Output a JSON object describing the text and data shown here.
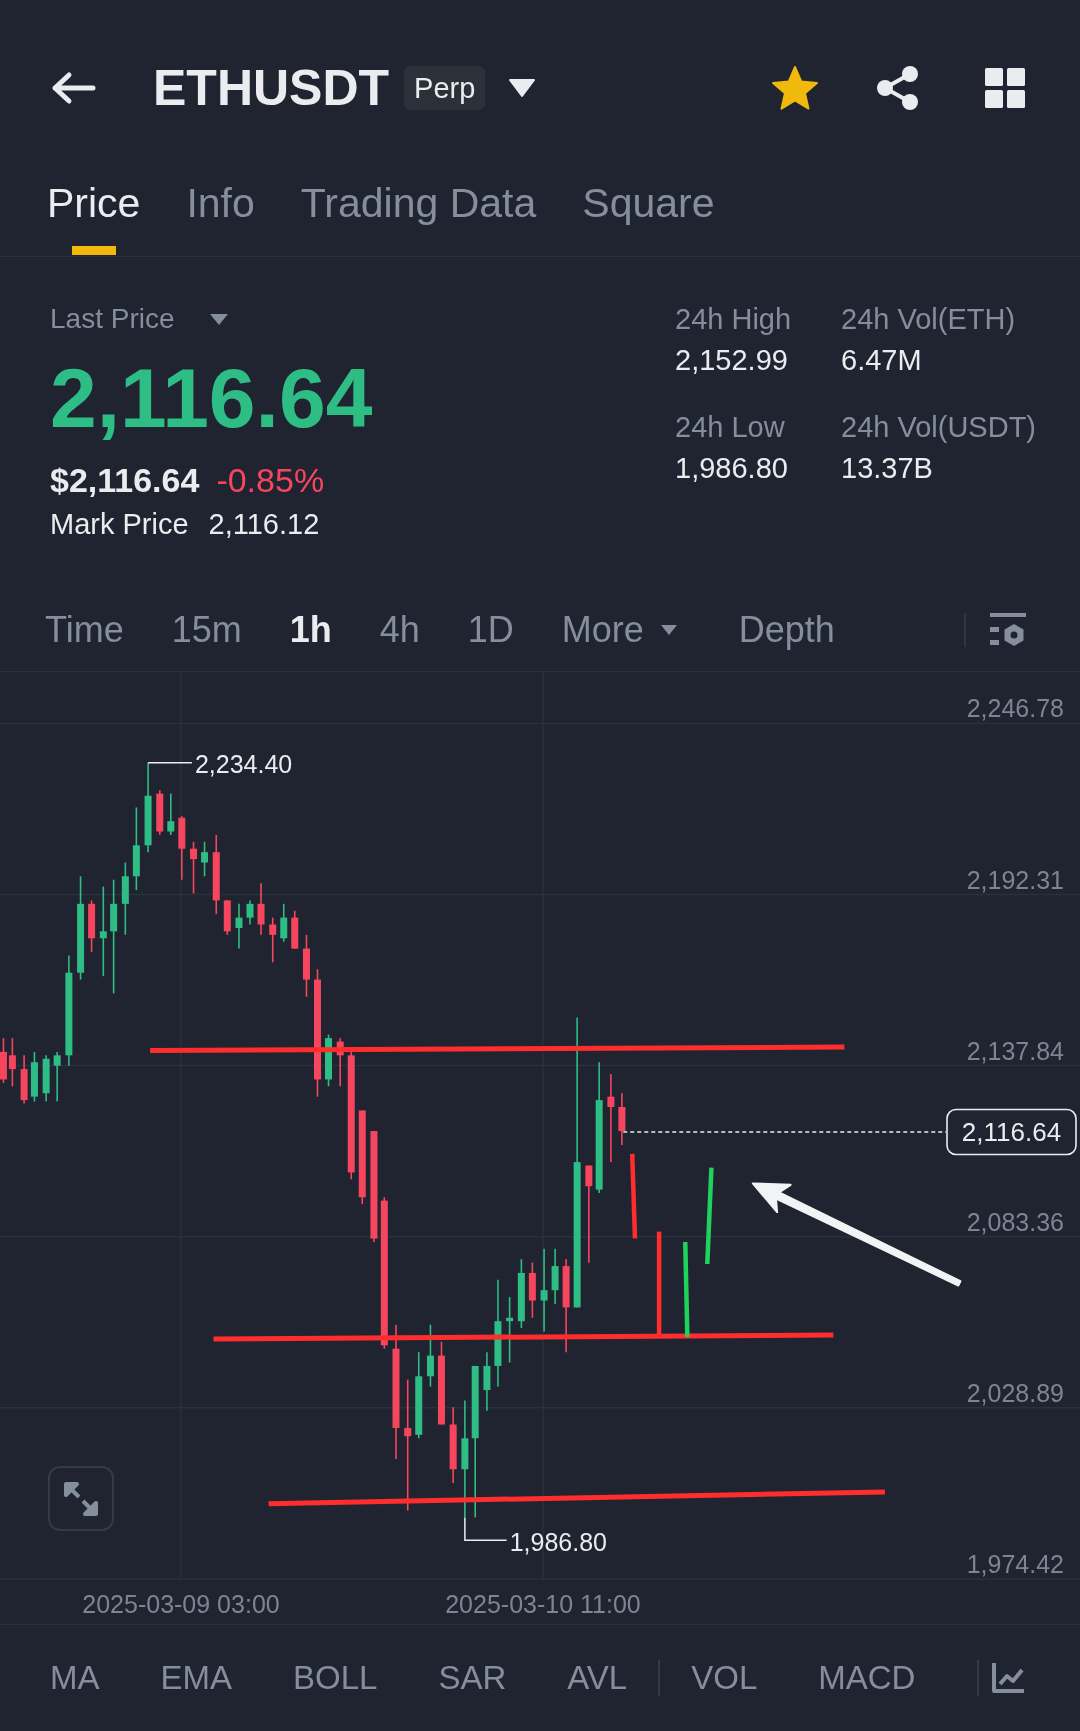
{
  "header": {
    "symbol": "ETHUSDT",
    "contract_type": "Perp",
    "favorite": true
  },
  "tabs": [
    {
      "label": "Price",
      "selected": true
    },
    {
      "label": "Info",
      "selected": false
    },
    {
      "label": "Trading Data",
      "selected": false
    },
    {
      "label": "Square",
      "selected": false
    }
  ],
  "ticker": {
    "price_selector": "Last Price",
    "last_price": "2,116.64",
    "last_price_up": true,
    "usd_price": "$2,116.64",
    "change": "-0.85%",
    "change_up": false,
    "mark_price_label": "Mark Price",
    "mark_price": "2,116.12"
  },
  "stats": [
    {
      "label": "24h High",
      "value": "2,152.99"
    },
    {
      "label": "24h Vol(ETH)",
      "value": "6.47M"
    },
    {
      "label": "24h Low",
      "value": "1,986.80"
    },
    {
      "label": "24h Vol(USDT)",
      "value": "13.37B"
    }
  ],
  "intervals": [
    {
      "label": "Time",
      "kind": "option",
      "selected": false
    },
    {
      "label": "15m",
      "kind": "option",
      "selected": false
    },
    {
      "label": "1h",
      "kind": "option",
      "selected": true
    },
    {
      "label": "4h",
      "kind": "option",
      "selected": false
    },
    {
      "label": "1D",
      "kind": "option",
      "selected": false
    },
    {
      "label": "More",
      "kind": "dropdown",
      "selected": false
    },
    {
      "label": "Depth",
      "kind": "view",
      "selected": false
    }
  ],
  "chart": {
    "price_labels": [
      "2,246.78",
      "2,192.31",
      "2,137.84",
      "2,083.36",
      "2,028.89",
      "1,974.42"
    ],
    "high_label": "2,234.40",
    "current_price": "2,116.64",
    "low_label": "1,986.80",
    "time_labels": [
      "2025-03-09 03:00",
      "2025-03-10 11:00"
    ]
  },
  "indicators": {
    "main": [
      "MA",
      "EMA",
      "BOLL",
      "SAR",
      "AVL"
    ],
    "sub": [
      "VOL",
      "MACD"
    ]
  }
}
